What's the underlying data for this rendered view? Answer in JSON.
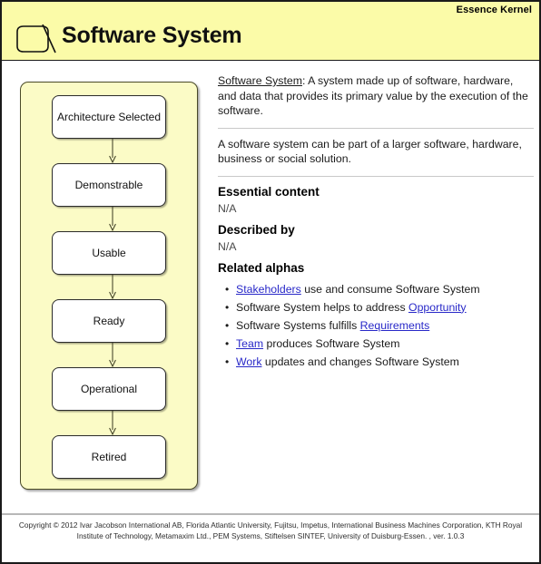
{
  "header": {
    "kernel_label": "Essence Kernel",
    "title": "Software System",
    "icon": "alpha-symbol-icon",
    "background_color": "#fbfba8"
  },
  "states_panel": {
    "name": "state-progression-diagram",
    "background_color": "#fbfbc6",
    "states": [
      {
        "label": "Architecture Selected"
      },
      {
        "label": "Demonstrable"
      },
      {
        "label": "Usable"
      },
      {
        "label": "Ready"
      },
      {
        "label": "Operational"
      },
      {
        "label": "Retired"
      }
    ]
  },
  "detail": {
    "definition": {
      "term": "Software System",
      "separator": ":",
      "text": " A system made up of software, hardware, and data that provides its primary value by the execution of the software."
    },
    "note": "A software system can be part of a larger software, hardware, business or social solution.",
    "sections": [
      {
        "heading": "Essential content",
        "value": "N/A"
      },
      {
        "heading": "Described by",
        "value": "N/A"
      }
    ],
    "related_alphas_heading": "Related alphas",
    "related_alphas": [
      {
        "pre": "",
        "link": "Stakeholders",
        "post": " use and consume Software System"
      },
      {
        "pre": "Software System helps to address ",
        "link": "Opportunity",
        "post": ""
      },
      {
        "pre": "Software Systems fulfills ",
        "link": "Requirements",
        "post": ""
      },
      {
        "pre": "",
        "link": "Team",
        "post": " produces Software System"
      },
      {
        "pre": "",
        "link": "Work",
        "post": " updates and changes Software System"
      }
    ],
    "link_color": "#2828c8"
  },
  "footer": {
    "line1": "Copyright © 2012 Ivar Jacobson International AB, Florida Atlantic University, Fujitsu, Impetus, International Business Machines Corporation, KTH Royal Institute of",
    "line2": "Technology, Metamaxim Ltd., PEM Systems, Stiftelsen SINTEF, University of Duisburg-Essen. , ver. 1.0.3"
  }
}
